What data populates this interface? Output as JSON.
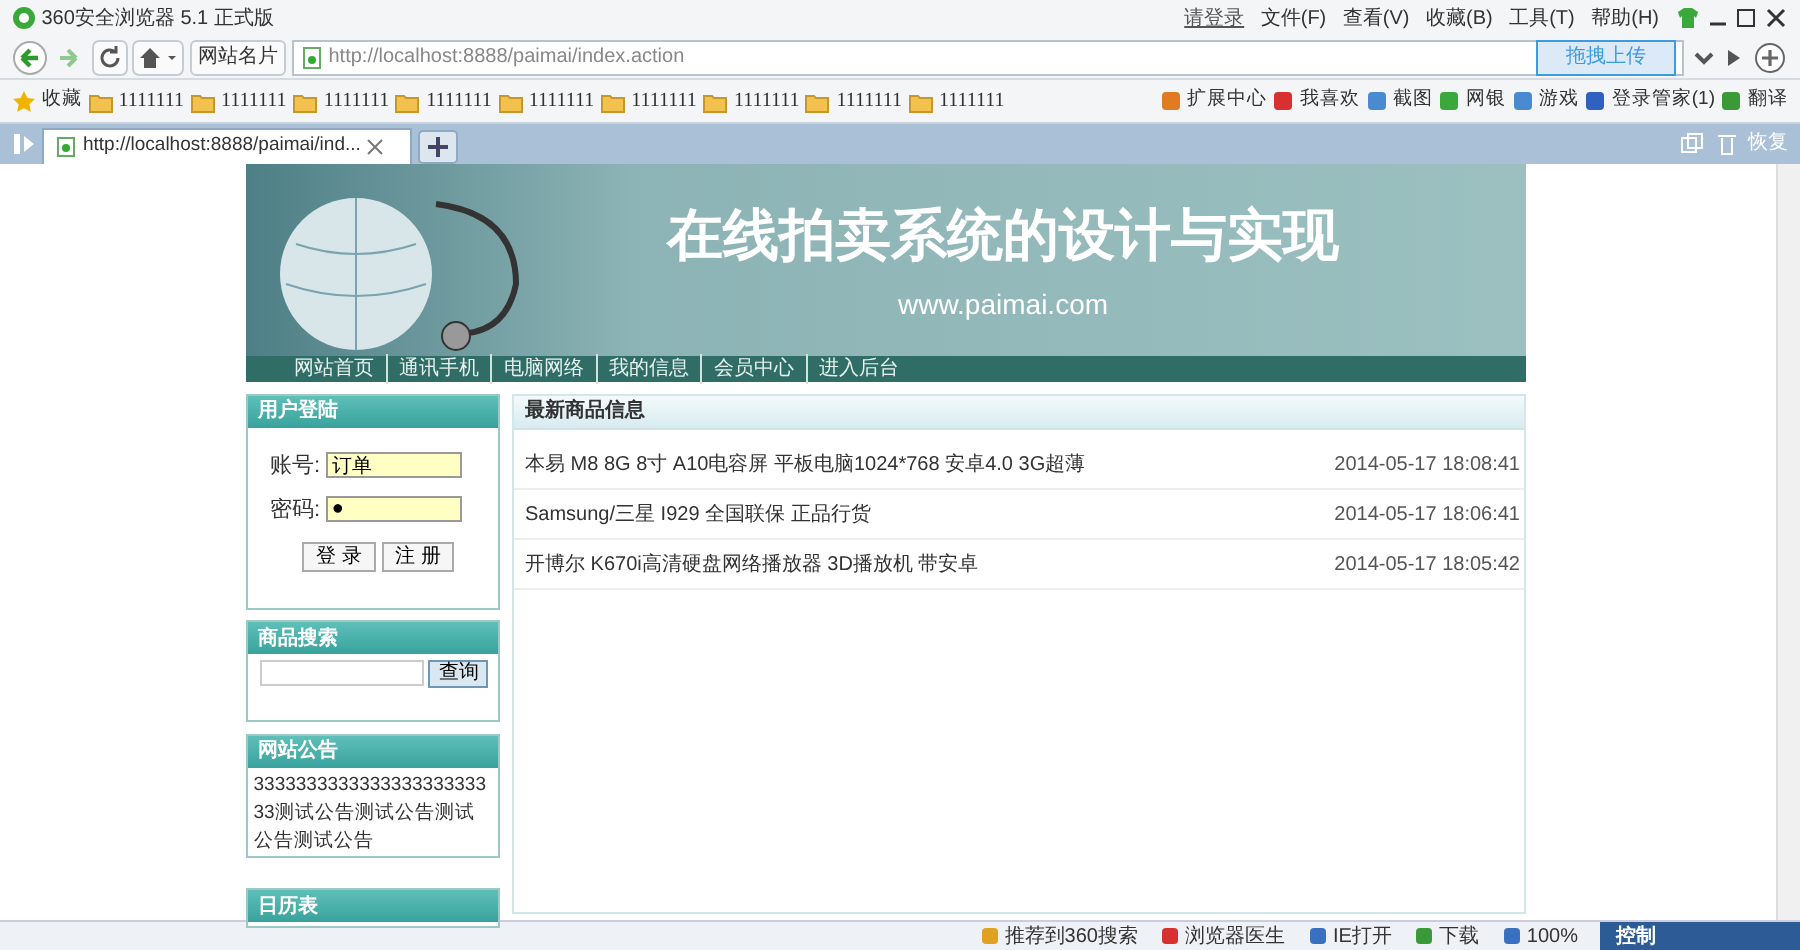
{
  "browser": {
    "title": "360安全浏览器 5.1 正式版",
    "menu": [
      {
        "label": "请登录"
      },
      {
        "label": "文件(F)"
      },
      {
        "label": "查看(V)"
      },
      {
        "label": "收藏(B)"
      },
      {
        "label": "工具(T)"
      },
      {
        "label": "帮助(H)"
      }
    ],
    "site_card": "网站名片",
    "address": "http://localhost:8888/paimai/index.action",
    "upload_button": "拖拽上传",
    "favorites_label": "收藏",
    "bookmarks": [
      "1111111",
      "1111111",
      "1111111",
      "1111111",
      "1111111",
      "1111111",
      "1111111",
      "1111111",
      "1111111"
    ],
    "tools": [
      "扩展中心",
      "我喜欢",
      "截图",
      "网银",
      "游戏",
      "登录管家(1)",
      "翻译"
    ],
    "tabs": [
      {
        "title": "http://localhost:8888/paimai/ind...",
        "selected": true
      }
    ],
    "restore": "恢复",
    "status_bar": [
      "推荐到360搜索",
      "浏览器医生",
      "IE打开",
      "下载",
      "100%"
    ],
    "status_panel": "控制"
  },
  "page": {
    "banner": {
      "title": "在线拍卖系统的设计与实现",
      "url": "www.paimai.com"
    },
    "nav": [
      "网站首页",
      "通讯手机",
      "电脑网络",
      "我的信息",
      "会员中心",
      "进入后台"
    ],
    "login": {
      "title": "用户登陆",
      "fields": [
        {
          "label": "账号:",
          "value": "订单"
        },
        {
          "label": "密码:",
          "value": "●"
        }
      ],
      "buttons": [
        "登 录",
        "注 册"
      ]
    },
    "search": {
      "title": "商品搜索",
      "button": "查询"
    },
    "notice": {
      "title": "网站公告",
      "text": "333333333333333333333333测试公告测试公告测试公告测试公告"
    },
    "calendar": {
      "title": "日历表"
    },
    "latest": {
      "title": "最新商品信息",
      "items": [
        {
          "name": "本易  M8 8G 8寸  A10电容屏  平板电脑1024*768 安卓4.0 3G超薄",
          "time": "2014-05-17 18:08:41"
        },
        {
          "name": "Samsung/三星  I929 全国联保  正品行货",
          "time": "2014-05-17 18:06:41"
        },
        {
          "name": "开博尔  K670i高清硬盘网络播放器  3D播放机  带安卓",
          "time": "2014-05-17 18:05:42"
        }
      ]
    }
  }
}
